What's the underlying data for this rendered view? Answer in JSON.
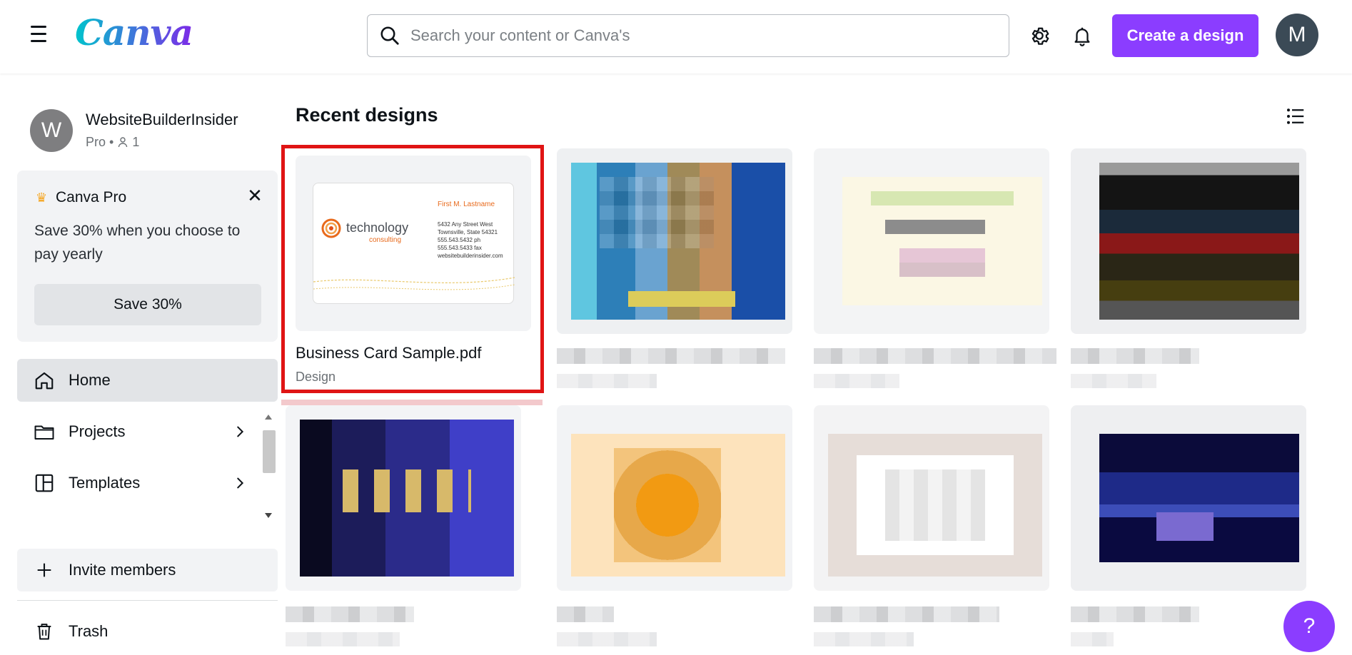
{
  "header": {
    "logo_text": "Canva",
    "search_placeholder": "Search your content or Canva's",
    "create_label": "Create a design",
    "user_initial": "M"
  },
  "sidebar": {
    "profile": {
      "initial": "W",
      "name": "WebsiteBuilderInsider",
      "plan": "Pro • ",
      "members": "1"
    },
    "promo": {
      "title": "Canva Pro",
      "text": "Save 30% when you choose to pay yearly",
      "button": "Save 30%",
      "close": "✕"
    },
    "nav": [
      {
        "label": "Home"
      },
      {
        "label": "Projects"
      },
      {
        "label": "Templates"
      },
      {
        "label": "Invite members"
      },
      {
        "label": "Trash"
      }
    ]
  },
  "main": {
    "section_title": "Recent designs",
    "designs": [
      {
        "title": "Business Card Sample.pdf",
        "type": "Design",
        "card": {
          "brand": "technology",
          "brand_sub": "consulting",
          "person": "First M. Lastname",
          "address1": "5432 Any Street West",
          "address2": "Townsville, State 54321",
          "phone": "555.543.5432 ph",
          "fax": "555.543.5433 fax",
          "web": "websitebuilderinsider.com"
        }
      }
    ]
  },
  "help_label": "?",
  "colors": {
    "accent": "#8b3dff",
    "highlight": "#e01414"
  }
}
